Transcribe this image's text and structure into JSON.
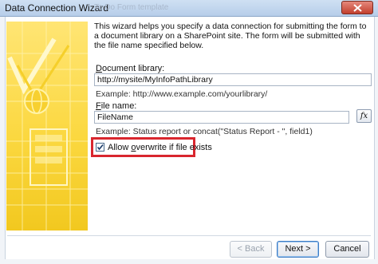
{
  "window": {
    "title": "Data Connection Wizard",
    "ghost_title": "To Do Form template",
    "close_label": "×"
  },
  "description": "This wizard helps you specify a data connection for submitting the form to a document library on a SharePoint site. The form will be submitted with the file name specified below.",
  "document_library": {
    "label_prefix": "D",
    "label_rest": "ocument library:",
    "value": "http://mysite/MyInfoPathLibrary",
    "example": "Example: http://www.example.com/yourlibrary/"
  },
  "file_name": {
    "label_prefix": "F",
    "label_rest": "ile name:",
    "value": "FileName",
    "example": "Example: Status report or concat(\"Status Report - \", field1)",
    "formula_button": "fx"
  },
  "allow_overwrite": {
    "checked": true,
    "label_before": "Allow ",
    "label_accel": "o",
    "label_after": "verwrite if file exists"
  },
  "buttons": {
    "back": "< Back",
    "next": "Next >",
    "cancel": "Cancel"
  },
  "colors": {
    "highlight": "#d9262e",
    "art_yellow": "#fbd840",
    "close": "#c2402e"
  }
}
